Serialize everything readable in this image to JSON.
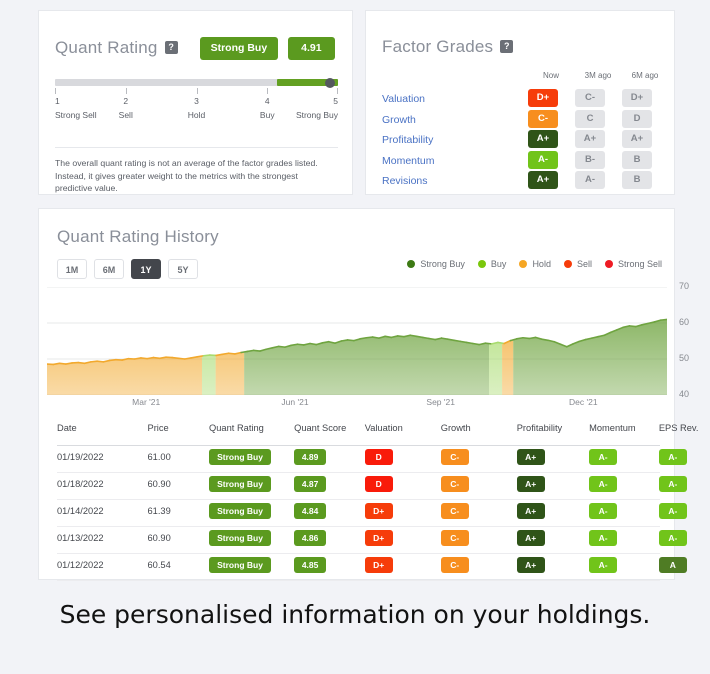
{
  "quant_rating": {
    "title": "Quant Rating",
    "help_icon": "?",
    "rating_label": "Strong Buy",
    "score": "4.91",
    "score_value": 4.91,
    "scale_min": 1,
    "scale_max": 5,
    "scale": [
      {
        "num": "1",
        "label": "Strong Sell"
      },
      {
        "num": "2",
        "label": "Sell"
      },
      {
        "num": "3",
        "label": "Hold"
      },
      {
        "num": "4",
        "label": "Buy"
      },
      {
        "num": "5",
        "label": "Strong Buy"
      }
    ],
    "note": "The overall quant rating is not an average of the factor grades listed. Instead, it gives greater weight to the metrics with the strongest predictive value."
  },
  "factor_grades": {
    "title": "Factor Grades",
    "help_icon": "?",
    "columns": [
      "Now",
      "3M ago",
      "6M ago"
    ],
    "rows": [
      {
        "name": "Valuation",
        "now": "D+",
        "now_color": "#f63c0a",
        "m3": "C-",
        "m6": "D+"
      },
      {
        "name": "Growth",
        "now": "C-",
        "now_color": "#f78e1e",
        "m3": "C",
        "m6": "D"
      },
      {
        "name": "Profitability",
        "now": "A+",
        "now_color": "#2f5418",
        "m3": "A+",
        "m6": "A+"
      },
      {
        "name": "Momentum",
        "now": "A-",
        "now_color": "#71c41a",
        "m3": "B-",
        "m6": "B"
      },
      {
        "name": "Revisions",
        "now": "A+",
        "now_color": "#2f5418",
        "m3": "A-",
        "m6": "B"
      }
    ]
  },
  "history": {
    "title": "Quant Rating History",
    "ranges": [
      {
        "label": "1M",
        "active": false
      },
      {
        "label": "6M",
        "active": false
      },
      {
        "label": "1Y",
        "active": true
      },
      {
        "label": "5Y",
        "active": false
      }
    ],
    "legend": [
      {
        "label": "Strong Buy",
        "color": "#3d7a14"
      },
      {
        "label": "Buy",
        "color": "#7ac70c"
      },
      {
        "label": "Hold",
        "color": "#f5a623"
      },
      {
        "label": "Sell",
        "color": "#f63c0a"
      },
      {
        "label": "Strong Sell",
        "color": "#ee1b24"
      }
    ]
  },
  "chart_data": {
    "type": "area",
    "title": "Quant Rating History",
    "xlabel": "",
    "ylabel": "",
    "ylim": [
      40,
      70
    ],
    "yticks": [
      40,
      50,
      60,
      70
    ],
    "ytick_labels": [
      "40",
      "50",
      "60",
      "70"
    ],
    "grid": true,
    "legend_position": "top-right",
    "xtick_labels": [
      "Mar '21",
      "Jun '21",
      "Sep '21",
      "Dec '21"
    ],
    "xtick_positions_pct": [
      16.0,
      40.0,
      63.5,
      86.5
    ],
    "series_name": "Price",
    "x": [
      0,
      1,
      2,
      3,
      4,
      5,
      6,
      7,
      8,
      9,
      10,
      11,
      12,
      13,
      14,
      15,
      16,
      17,
      18,
      19,
      20,
      21,
      22,
      23,
      24,
      25,
      26,
      27,
      28,
      29,
      30,
      31,
      32,
      33,
      34,
      35,
      36,
      37,
      38,
      39,
      40,
      41,
      42,
      43,
      44,
      45,
      46,
      47,
      48,
      49,
      50,
      51,
      52,
      53,
      54,
      55,
      56,
      57,
      58,
      59,
      60,
      61,
      62,
      63,
      64,
      65,
      66,
      67,
      68,
      69,
      70,
      71,
      72,
      73,
      74,
      75,
      76,
      77,
      78,
      79,
      80,
      81,
      82,
      83,
      84,
      85,
      86,
      87,
      88,
      89,
      90,
      91,
      92,
      93,
      94,
      95,
      96,
      97,
      98,
      99
    ],
    "values": [
      48.6,
      48.5,
      48.8,
      48.6,
      48.9,
      49.0,
      48.8,
      49.2,
      49.4,
      49.2,
      49.6,
      49.8,
      49.7,
      50.1,
      50.0,
      50.3,
      50.1,
      50.4,
      50.2,
      50.5,
      50.4,
      50.2,
      50.0,
      50.3,
      50.6,
      50.9,
      51.1,
      51.0,
      51.3,
      51.6,
      51.4,
      51.8,
      52.1,
      52.4,
      52.2,
      52.7,
      53.1,
      53.5,
      53.3,
      53.8,
      54.1,
      53.9,
      54.3,
      54.0,
      54.5,
      54.8,
      54.4,
      55.0,
      55.3,
      55.1,
      55.6,
      55.9,
      56.1,
      55.8,
      56.3,
      56.0,
      56.4,
      56.2,
      56.6,
      56.3,
      56.0,
      55.7,
      55.4,
      55.8,
      55.5,
      55.2,
      54.9,
      54.6,
      54.3,
      54.0,
      54.4,
      54.2,
      54.6,
      54.3,
      55.1,
      55.6,
      55.9,
      55.7,
      56.0,
      55.5,
      55.2,
      54.8,
      54.1,
      53.4,
      54.2,
      54.9,
      55.4,
      55.8,
      56.2,
      56.6,
      57.4,
      58.1,
      58.8,
      59.2,
      59.0,
      59.5,
      59.9,
      60.3,
      60.8,
      61.0
    ],
    "rating_bands": [
      {
        "rating": "Hold",
        "color": "#f5a623",
        "start_pct": 0.0,
        "end_pct": 63.0
      },
      {
        "rating": "Buy",
        "color": "#9fd858",
        "start_pct": 63.0,
        "end_pct": 66.5
      },
      {
        "rating": "Hold",
        "color": "#f5a623",
        "start_pct": 66.5,
        "end_pct": 76.5
      },
      {
        "rating": "Strong Buy",
        "color": "#6a9e3c",
        "start_pct": 76.5,
        "end_pct": 71.0
      },
      {
        "rating": "Strong Buy",
        "color": "#6a9e3c",
        "start_pct": 71.0,
        "end_pct": 100.0
      }
    ],
    "bands_ordered": [
      {
        "rating": "Hold",
        "color": "#f2a92e",
        "left_pct": 0.0,
        "width_pct": 25.0
      },
      {
        "rating": "Buy",
        "color": "#a8db6e",
        "left_pct": 25.0,
        "width_pct": 2.2
      },
      {
        "rating": "Hold",
        "color": "#f2a92e",
        "left_pct": 27.2,
        "width_pct": 4.6
      },
      {
        "rating": "Strong Buy",
        "color": "#6fa440",
        "left_pct": 31.8,
        "width_pct": 39.5
      },
      {
        "rating": "Buy",
        "color": "#a8db6e",
        "left_pct": 71.3,
        "width_pct": 2.1
      },
      {
        "rating": "Hold",
        "color": "#f2a92e",
        "left_pct": 73.4,
        "width_pct": 1.8
      },
      {
        "rating": "Strong Buy",
        "color": "#6fa440",
        "left_pct": 75.2,
        "width_pct": 24.8
      }
    ]
  },
  "table": {
    "columns": [
      "Date",
      "Price",
      "Quant Rating",
      "Quant Score",
      "Valuation",
      "Growth",
      "Profitability",
      "Momentum",
      "EPS Rev."
    ],
    "rows": [
      {
        "date": "01/19/2022",
        "price": "61.00",
        "rating": "Strong Buy",
        "score": "4.89",
        "valuation": "D",
        "valuation_color": "#f91b0a",
        "growth": "C-",
        "growth_color": "#f78e1e",
        "profitability": "A+",
        "profitability_color": "#2f5418",
        "momentum": "A-",
        "momentum_color": "#71c41a",
        "eps_rev": "A-",
        "eps_rev_color": "#71c41a"
      },
      {
        "date": "01/18/2022",
        "price": "60.90",
        "rating": "Strong Buy",
        "score": "4.87",
        "valuation": "D",
        "valuation_color": "#f91b0a",
        "growth": "C-",
        "growth_color": "#f78e1e",
        "profitability": "A+",
        "profitability_color": "#2f5418",
        "momentum": "A-",
        "momentum_color": "#71c41a",
        "eps_rev": "A-",
        "eps_rev_color": "#71c41a"
      },
      {
        "date": "01/14/2022",
        "price": "61.39",
        "rating": "Strong Buy",
        "score": "4.84",
        "valuation": "D+",
        "valuation_color": "#f63c0a",
        "growth": "C-",
        "growth_color": "#f78e1e",
        "profitability": "A+",
        "profitability_color": "#2f5418",
        "momentum": "A-",
        "momentum_color": "#71c41a",
        "eps_rev": "A-",
        "eps_rev_color": "#71c41a"
      },
      {
        "date": "01/13/2022",
        "price": "60.90",
        "rating": "Strong Buy",
        "score": "4.86",
        "valuation": "D+",
        "valuation_color": "#f63c0a",
        "growth": "C-",
        "growth_color": "#f78e1e",
        "profitability": "A+",
        "profitability_color": "#2f5418",
        "momentum": "A-",
        "momentum_color": "#71c41a",
        "eps_rev": "A-",
        "eps_rev_color": "#71c41a"
      },
      {
        "date": "01/12/2022",
        "price": "60.54",
        "rating": "Strong Buy",
        "score": "4.85",
        "valuation": "D+",
        "valuation_color": "#f63c0a",
        "growth": "C-",
        "growth_color": "#f78e1e",
        "profitability": "A+",
        "profitability_color": "#2f5418",
        "momentum": "A-",
        "momentum_color": "#71c41a",
        "eps_rev": "A",
        "eps_rev_color": "#4f7c24"
      }
    ]
  },
  "caption": "See personalised information on your holdings."
}
